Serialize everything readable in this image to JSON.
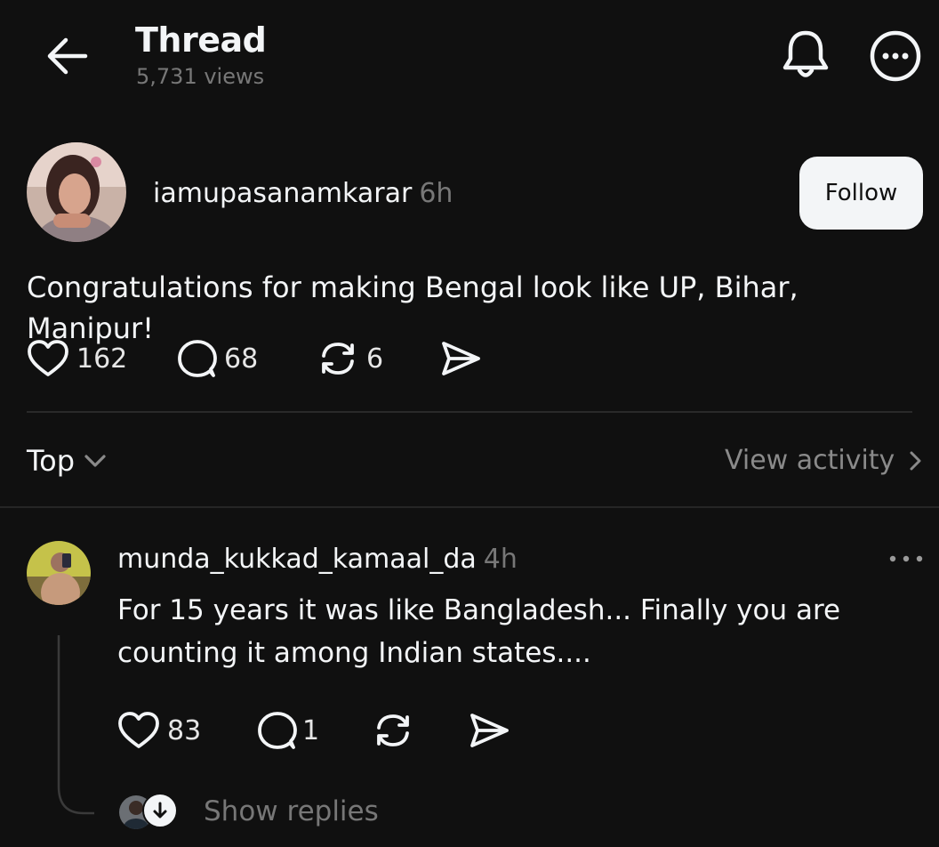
{
  "header": {
    "title": "Thread",
    "views": "5,731 views",
    "icons": [
      "back-arrow-icon",
      "bell-icon",
      "more-circle-icon"
    ]
  },
  "post": {
    "username": "iamupasanamkarar",
    "time": "6h",
    "follow_label": "Follow",
    "text": "Congratulations for making Bengal look like UP, Bihar, Manipur!",
    "likes": "162",
    "comments": "68",
    "reposts": "6"
  },
  "sort": {
    "label": "Top",
    "view_activity": "View activity"
  },
  "reply": {
    "username": "munda_kukkad_kamaal_da",
    "time": "4h",
    "text": "For 15 years it was like Bangladesh... Finally you are counting it among Indian states....",
    "likes": "83",
    "comments": "1",
    "show_replies": "Show replies"
  },
  "colors": {
    "background": "#101010",
    "text": "#f3f5f7",
    "muted": "#777777",
    "divider": "#2a2a2a"
  }
}
